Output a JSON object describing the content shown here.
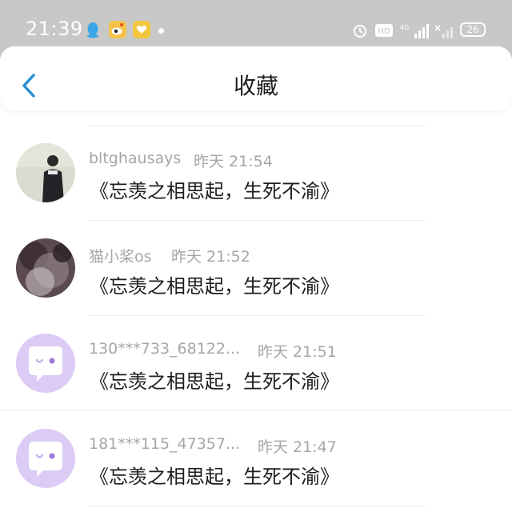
{
  "status_bar": {
    "time": "21:39",
    "network": "4G",
    "battery": "26"
  },
  "header": {
    "title": "收藏"
  },
  "favorites": [
    {
      "user": "bltghausays",
      "time": "昨天 21:54",
      "message": "《忘羡之相思起，生死不渝》"
    },
    {
      "user": "猫小桨os",
      "time": "昨天 21:52",
      "message": "《忘羡之相思起，生死不渝》"
    },
    {
      "user": "130***733_68122...",
      "time": "昨天 21:51",
      "message": "《忘羡之相思起，生死不渝》"
    },
    {
      "user": "181***115_47357...",
      "time": "昨天 21:47",
      "message": "《忘羡之相思起，生死不渝》"
    }
  ],
  "colors": {
    "accent": "#2a8fd6",
    "default_avatar": "#dccbf5"
  }
}
